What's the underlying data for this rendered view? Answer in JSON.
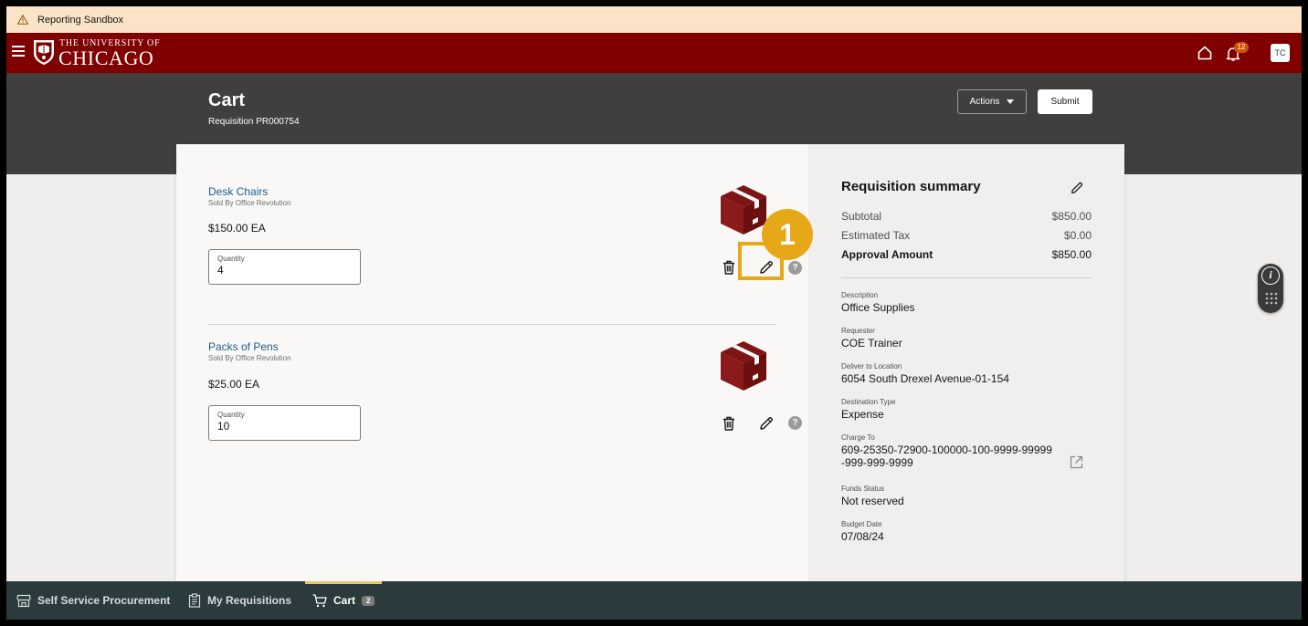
{
  "environment_banner": {
    "text": "Reporting Sandbox",
    "icon": "warning-icon"
  },
  "brand": {
    "line1": "THE UNIVERSITY OF",
    "line2": "CHICAGO"
  },
  "header_icons": {
    "notifications_count": "12",
    "user_initials": "TC"
  },
  "page": {
    "title": "Cart",
    "requisition": "Requisition PR000754",
    "actions_label": "Actions",
    "submit_label": "Submit"
  },
  "items": [
    {
      "name": "Desk Chairs",
      "seller": "Sold By Office Revolution",
      "price": "$150.00 EA",
      "quantity_label": "Quantity",
      "quantity": "4"
    },
    {
      "name": "Packs of Pens",
      "seller": "Sold By Office Revolution",
      "price": "$25.00 EA",
      "quantity_label": "Quantity",
      "quantity": "10"
    }
  ],
  "callout": {
    "step": "1"
  },
  "summary": {
    "title": "Requisition summary",
    "subtotal_label": "Subtotal",
    "subtotal": "$850.00",
    "tax_label": "Estimated Tax",
    "tax": "$0.00",
    "approval_label": "Approval Amount",
    "approval": "$850.00",
    "fields": [
      {
        "label": "Description",
        "value": "Office Supplies"
      },
      {
        "label": "Requester",
        "value": "COE Trainer"
      },
      {
        "label": "Deliver to Location",
        "value": "6054 South Drexel Avenue-01-154"
      },
      {
        "label": "Destination Type",
        "value": "Expense"
      },
      {
        "label": "Charge To",
        "value": "609-25350-72900-100000-100-9999-99999-999-999-9999"
      },
      {
        "label": "Funds Status",
        "value": "Not reserved"
      },
      {
        "label": "Budget Date",
        "value": "07/08/24"
      }
    ]
  },
  "bottom_nav": [
    {
      "label": "Self Service Procurement",
      "icon": "store-icon"
    },
    {
      "label": "My Requisitions",
      "icon": "clipboard-icon"
    },
    {
      "label": "Cart",
      "icon": "cart-icon",
      "badge": "2",
      "active": true
    }
  ],
  "colors": {
    "brand": "#800000",
    "callout": "#e6a817",
    "header": "#403f3d",
    "nav": "#2a3a3d",
    "link": "#1e5b8a"
  }
}
